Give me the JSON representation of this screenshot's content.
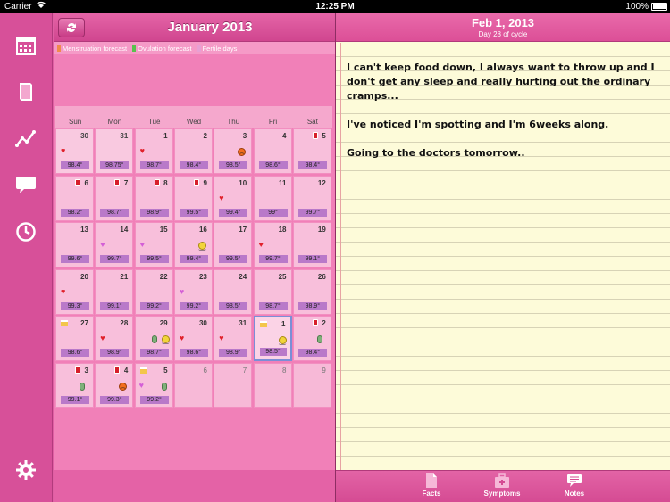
{
  "status_bar": {
    "carrier": "Carrier",
    "time": "12:25 PM",
    "battery": "100%"
  },
  "sidebar": {
    "items": [
      {
        "name": "calendar-icon"
      },
      {
        "name": "book-icon"
      },
      {
        "name": "chart-line-icon"
      },
      {
        "name": "speech-bubble-icon"
      },
      {
        "name": "clock-icon"
      },
      {
        "name": "gear-icon"
      }
    ]
  },
  "calendar": {
    "title": "January 2013",
    "legend": [
      {
        "label": "Menstruation forecast",
        "color": "#f08a4b"
      },
      {
        "label": "Ovulation forecast",
        "color": "#58c24d"
      },
      {
        "label": "Fertile days",
        "color": "#e7a0d4"
      }
    ],
    "weekdays": [
      "Sun",
      "Mon",
      "Tue",
      "Wed",
      "Thu",
      "Fri",
      "Sat"
    ],
    "weeks": [
      [
        {
          "day": "30",
          "temp": "98.4°",
          "icons": [
            "heart"
          ],
          "dim": true
        },
        {
          "day": "31",
          "temp": "98.75°",
          "icons": [],
          "dim": true
        },
        {
          "day": "1",
          "temp": "98.7°",
          "icons": [
            "heart"
          ]
        },
        {
          "day": "2",
          "temp": "98.4°",
          "icons": []
        },
        {
          "day": "3",
          "temp": "98.5°",
          "icons": [
            "sad"
          ]
        },
        {
          "day": "4",
          "temp": "98.6°",
          "icons": []
        },
        {
          "day": "5",
          "temp": "98.4°",
          "icons": [
            "pad"
          ]
        }
      ],
      [
        {
          "day": "6",
          "temp": "98.2°",
          "icons": [
            "pad"
          ]
        },
        {
          "day": "7",
          "temp": "98.7°",
          "icons": [
            "pad"
          ]
        },
        {
          "day": "8",
          "temp": "98.9°",
          "icons": [
            "pad"
          ]
        },
        {
          "day": "9",
          "temp": "99.5°",
          "icons": [
            "pad"
          ]
        },
        {
          "day": "10",
          "temp": "99.4°",
          "icons": [
            "heart"
          ]
        },
        {
          "day": "11",
          "temp": "99°",
          "icons": []
        },
        {
          "day": "12",
          "temp": "99.7°",
          "icons": []
        }
      ],
      [
        {
          "day": "13",
          "temp": "99.6°",
          "icons": []
        },
        {
          "day": "14",
          "temp": "99.7°",
          "icons": [
            "heart-pink"
          ]
        },
        {
          "day": "15",
          "temp": "99.5°",
          "icons": [
            "heart-pink"
          ]
        },
        {
          "day": "16",
          "temp": "99.4°",
          "icons": [
            "smile"
          ]
        },
        {
          "day": "17",
          "temp": "99.5°",
          "icons": []
        },
        {
          "day": "18",
          "temp": "99.7°",
          "icons": [
            "heart"
          ]
        },
        {
          "day": "19",
          "temp": "99.1°",
          "icons": []
        }
      ],
      [
        {
          "day": "20",
          "temp": "99.3°",
          "icons": [
            "heart"
          ]
        },
        {
          "day": "21",
          "temp": "99.1°",
          "icons": []
        },
        {
          "day": "22",
          "temp": "99.2°",
          "icons": []
        },
        {
          "day": "23",
          "temp": "99.2°",
          "icons": [
            "heart-pink"
          ]
        },
        {
          "day": "24",
          "temp": "98.5°",
          "icons": []
        },
        {
          "day": "25",
          "temp": "98.7°",
          "icons": []
        },
        {
          "day": "26",
          "temp": "98.9°",
          "icons": []
        }
      ],
      [
        {
          "day": "27",
          "temp": "98.6°",
          "icons": [
            "cake"
          ]
        },
        {
          "day": "28",
          "temp": "98.9°",
          "icons": [
            "heart"
          ]
        },
        {
          "day": "29",
          "temp": "98.7°",
          "icons": [
            "pill",
            "smile"
          ]
        },
        {
          "day": "30",
          "temp": "98.6°",
          "icons": [
            "heart"
          ]
        },
        {
          "day": "31",
          "temp": "98.9°",
          "icons": [
            "heart"
          ]
        },
        {
          "day": "1",
          "temp": "98.5°",
          "icons": [
            "cake",
            "smile"
          ],
          "selected": true
        },
        {
          "day": "2",
          "temp": "98.4°",
          "icons": [
            "pad",
            "pill"
          ]
        }
      ],
      [
        {
          "day": "3",
          "temp": "99.1°",
          "icons": [
            "pad",
            "pill"
          ]
        },
        {
          "day": "4",
          "temp": "99.3°",
          "icons": [
            "pad",
            "sad"
          ]
        },
        {
          "day": "5",
          "temp": "99.2°",
          "icons": [
            "cake",
            "heart-pink",
            "pill"
          ]
        },
        {
          "day": "6",
          "temp": "",
          "icons": [],
          "empty": true
        },
        {
          "day": "7",
          "temp": "",
          "icons": [],
          "empty": true
        },
        {
          "day": "8",
          "temp": "",
          "icons": [],
          "empty": true
        },
        {
          "day": "9",
          "temp": "",
          "icons": [],
          "empty": true
        }
      ]
    ]
  },
  "notes": {
    "date": "Feb 1, 2013",
    "cycle": "Day 28 of cycle",
    "paragraphs": [
      "I can't keep food down, I always want to throw up and I don't get any sleep and really hurting out the ordinary cramps...",
      "I've noticed I'm spotting and I'm 6weeks along.",
      "Going to the doctors tomorrow.."
    ]
  },
  "tabs": [
    {
      "label": "Facts",
      "icon": "document-icon"
    },
    {
      "label": "Symptoms",
      "icon": "medical-kit-icon"
    },
    {
      "label": "Notes",
      "icon": "speech-bubble-icon"
    }
  ]
}
